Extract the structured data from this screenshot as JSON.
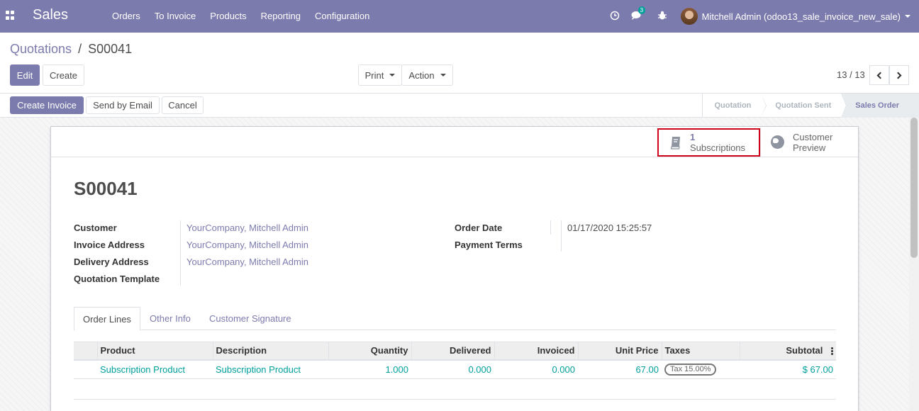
{
  "app": {
    "name": "Sales"
  },
  "menu": [
    {
      "label": "Orders"
    },
    {
      "label": "To Invoice"
    },
    {
      "label": "Products"
    },
    {
      "label": "Reporting"
    },
    {
      "label": "Configuration"
    }
  ],
  "systray": {
    "messages_count": "3",
    "user_name": "Mitchell Admin (odoo13_sale_invoice_new_sale)"
  },
  "breadcrumb": {
    "parent": "Quotations",
    "separator": "/",
    "current": "S00041"
  },
  "buttons": {
    "edit": "Edit",
    "create": "Create",
    "print": "Print",
    "action": "Action",
    "create_invoice": "Create Invoice",
    "send_by_email": "Send by Email",
    "cancel": "Cancel"
  },
  "pager": {
    "value": "13 / 13"
  },
  "stages": [
    {
      "label": "Quotation",
      "active": false
    },
    {
      "label": "Quotation Sent",
      "active": false
    },
    {
      "label": "Sales Order",
      "active": true
    }
  ],
  "smart_buttons": {
    "subscriptions": {
      "count": "1",
      "label": "Subscriptions"
    },
    "preview": {
      "line1": "Customer",
      "line2": "Preview"
    }
  },
  "record": {
    "name": "S00041",
    "customer_label": "Customer",
    "customer": "YourCompany, Mitchell Admin",
    "invoice_address_label": "Invoice Address",
    "invoice_address": "YourCompany, Mitchell Admin",
    "delivery_address_label": "Delivery Address",
    "delivery_address": "YourCompany, Mitchell Admin",
    "template_label": "Quotation Template",
    "order_date_label": "Order Date",
    "order_date": "01/17/2020 15:25:57",
    "payment_terms_label": "Payment Terms"
  },
  "tabs": [
    {
      "label": "Order Lines",
      "active": true
    },
    {
      "label": "Other Info",
      "active": false
    },
    {
      "label": "Customer Signature",
      "active": false
    }
  ],
  "table": {
    "headers": [
      "Product",
      "Description",
      "Quantity",
      "Delivered",
      "Invoiced",
      "Unit Price",
      "Taxes",
      "Subtotal"
    ],
    "rows": [
      {
        "product": "Subscription Product",
        "description": "Subscription Product",
        "quantity": "1.000",
        "delivered": "0.000",
        "invoiced": "0.000",
        "unit_price": "67.00",
        "tax": "Tax 15.00%",
        "subtotal": "$ 67.00"
      }
    ]
  },
  "colors": {
    "brand": "#7c7bad",
    "link_teal": "#00a09d",
    "highlight": "#d0021b"
  }
}
